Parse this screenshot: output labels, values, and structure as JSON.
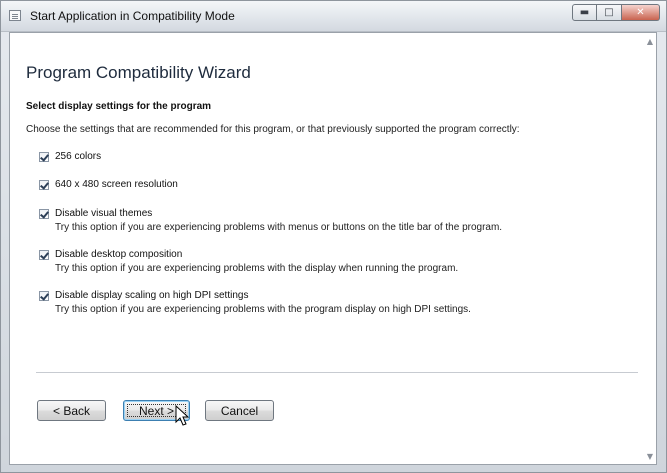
{
  "window": {
    "title": "Start Application in Compatibility Mode",
    "controls": [
      "minimize",
      "maximize",
      "close"
    ]
  },
  "wizard": {
    "heading": "Program Compatibility Wizard",
    "subheading": "Select display settings for the program",
    "instructions": "Choose the settings that are recommended for this program, or that previously supported the program correctly:",
    "options": [
      {
        "label": "256 colors",
        "checked": true,
        "description": ""
      },
      {
        "label": "640 x 480 screen resolution",
        "checked": true,
        "description": ""
      },
      {
        "label": "Disable visual themes",
        "checked": true,
        "description": "Try this option if you are experiencing problems with menus or buttons on the title bar of the program."
      },
      {
        "label": "Disable desktop composition",
        "checked": true,
        "description": "Try this option if you are experiencing problems with the display when running the program."
      },
      {
        "label": "Disable display scaling on high DPI settings",
        "checked": true,
        "description": "Try this option if you are experiencing problems with the program display on high DPI settings."
      }
    ]
  },
  "buttons": {
    "back": "< Back",
    "next": "Next >",
    "cancel": "Cancel"
  }
}
